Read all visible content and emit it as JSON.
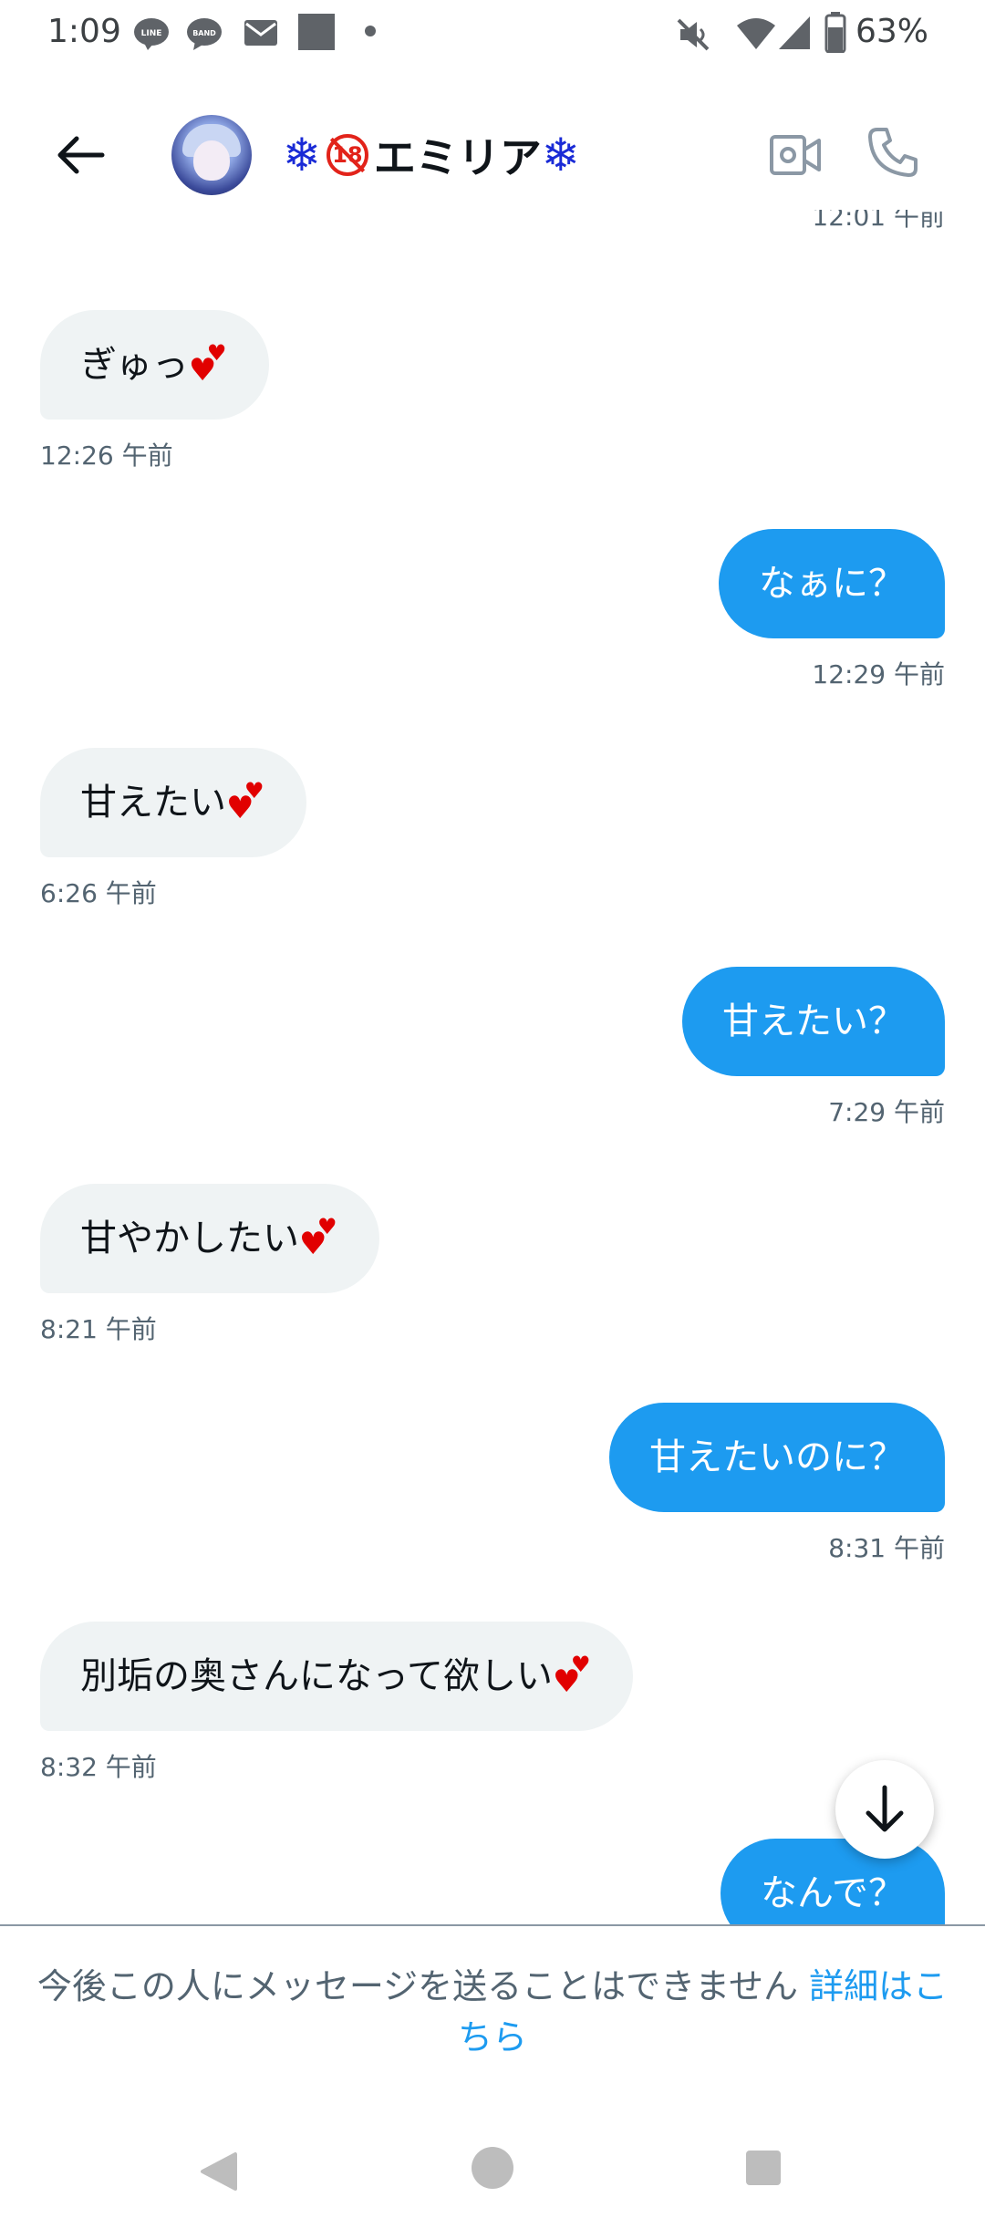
{
  "status_bar": {
    "time": "1:09",
    "battery_percent": "63%",
    "icons": [
      "line-icon",
      "band-icon",
      "mail-icon",
      "image-icon",
      "mute-icon",
      "wifi-icon",
      "signal-icon",
      "battery-icon"
    ],
    "line_label": "LINE",
    "band_label": "BAND"
  },
  "header": {
    "snow_left": "❄",
    "age_badge": "18",
    "name": "エミリア",
    "snow_right": "❄"
  },
  "messages": {
    "top_partial_timestamp": "12:01 午前",
    "items": [
      {
        "direction": "received",
        "text": "ぎゅっ",
        "heart": true,
        "time": "12:26 午前"
      },
      {
        "direction": "sent",
        "text": "なぁに？",
        "heart": false,
        "time": "12:29 午前"
      },
      {
        "direction": "received",
        "text": "甘えたい",
        "heart": true,
        "time": "6:26 午前"
      },
      {
        "direction": "sent",
        "text": "甘えたい？",
        "heart": false,
        "time": "7:29 午前"
      },
      {
        "direction": "received",
        "text": "甘やかしたい",
        "heart": true,
        "time": "8:21 午前"
      },
      {
        "direction": "sent",
        "text": "甘えたいのに？",
        "heart": false,
        "time": "8:31 午前"
      },
      {
        "direction": "received",
        "text": "別垢の奥さんになって欲しい",
        "heart": true,
        "time": "8:32 午前"
      },
      {
        "direction": "sent",
        "text": "なんで？",
        "heart": false,
        "time": ""
      }
    ]
  },
  "footer": {
    "notice_text": "今後この人にメッセージを送ることはできません",
    "notice_link": "詳細はこちら"
  },
  "colors": {
    "sent_bubble": "#1d9bf0",
    "received_bubble": "#eff3f4",
    "heart": "#e10000",
    "link": "#1d9bf0"
  }
}
